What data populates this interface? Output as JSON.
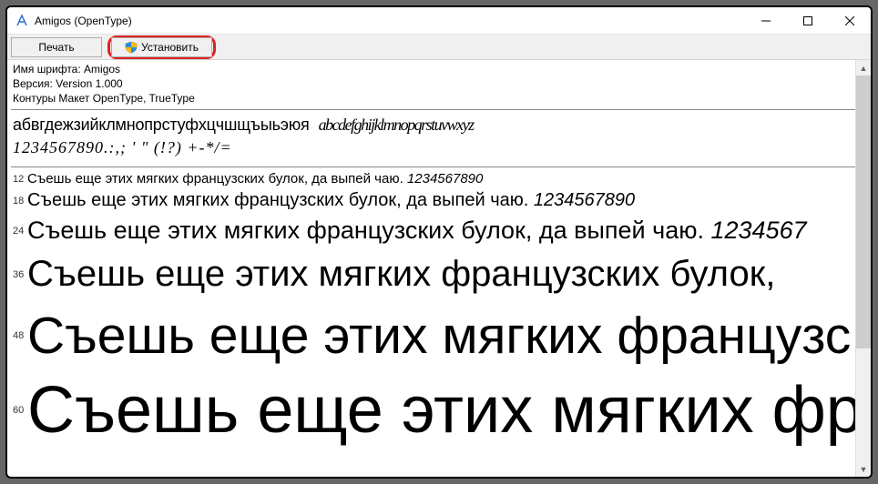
{
  "window": {
    "title": "Amigos (OpenType)"
  },
  "toolbar": {
    "print_label": "Печать",
    "install_label": "Установить"
  },
  "meta": {
    "font_name_line": "Имя шрифта: Amigos",
    "version_line": "Версия: Version 1.000",
    "outline_line": "Контуры Макет OpenType, TrueType"
  },
  "preview": {
    "alphabet_regular": "абвгдежзийклмнопрстуфхцчшщъыьэюя",
    "alphabet_italic": "abcdefghijklmnopqrstuvwxyz",
    "digits_row": "1234567890.:,; ' \" (!?) +-*/=",
    "samples": [
      {
        "size_label": "12",
        "text": "Съешь еще этих мягких французских булок, да выпей чаю.",
        "digits": "1234567890"
      },
      {
        "size_label": "18",
        "text": "Съешь еще этих мягких французских булок, да выпей чаю.",
        "digits": "1234567890"
      },
      {
        "size_label": "24",
        "text": "Съешь еще этих мягких французских булок, да выпей чаю.",
        "digits": "1234567"
      },
      {
        "size_label": "36",
        "text": "Съешь еще этих мягких французских булок,",
        "digits": ""
      },
      {
        "size_label": "48",
        "text": "Съешь еще этих мягких французс",
        "digits": ""
      },
      {
        "size_label": "60",
        "text": "Съешь еще этих мягких фр",
        "digits": ""
      }
    ]
  }
}
